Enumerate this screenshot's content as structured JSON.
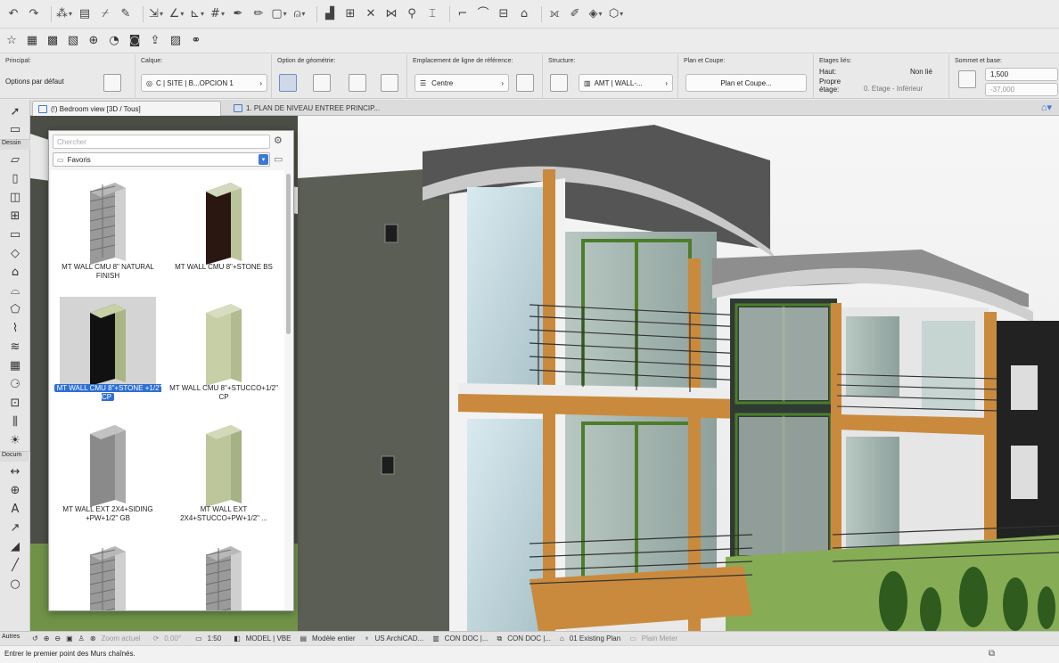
{
  "colors": {
    "accent": "#2f6fd6",
    "sky": "#f3f3f3",
    "grass": "#86ad55"
  },
  "toolbar1": [
    "undo-icon",
    "redo-icon",
    "magic-wand-icon",
    "layout-icon",
    "eyedropper-icon",
    "injection-icon",
    "arrow-tool-icon",
    "angle-icon",
    "snap-guide-icon",
    "grid-snap-icon",
    "pen-icon",
    "pencil-icon",
    "square-icon",
    "lock-icon",
    "stair-icon",
    "table-icon",
    "cross-icon",
    "split-icon",
    "magnify-icon",
    "trim-icon",
    "corner-icon",
    "curve-icon",
    "align-icon",
    "home-icon",
    "intersect-icon",
    "paint-icon",
    "layers-icon",
    "view-3d-icon"
  ],
  "toolbar2": [
    "star-icon",
    "plan-icon",
    "section-icon",
    "map-icon",
    "globe-icon",
    "camera-icon",
    "render-icon",
    "publish-icon",
    "detail-icon",
    "teamwork-icon"
  ],
  "info": {
    "principal_label": "Principal:",
    "principal_value": "Options par défaut",
    "calque_label": "Calque:",
    "calque_value": "C | SITE | B...OPCION 1",
    "geometry_label": "Option de géométrie:",
    "refline_label": "Emplacement de ligne de référence:",
    "refline_value": "Centre",
    "structure_label": "Structure:",
    "structure_value": "AMT | WALL-...",
    "plancoupe_label": "Plan et Coupe:",
    "plancoupe_value": "Plan et Coupe...",
    "etages_label": "Etages liés:",
    "haut_label": "Haut:",
    "haut_value": "Non lié",
    "propre_label": "Propre\nétage:",
    "propre_value": "0. Etage - Inférieur",
    "sommet_label": "Sommet et base:",
    "sommet_value": "1,500",
    "base_value": "-37,000"
  },
  "tabs": [
    "(!) Bedroom view [3D / Tous]",
    "1. PLAN DE NIVEAU ENTREE PRINCIP..."
  ],
  "left_sections": {
    "dessin": "Dessin",
    "docum": "Docum",
    "autres": "Autres"
  },
  "left_tools_top": [
    "pointer-icon",
    "marquee-icon"
  ],
  "left_tools_dessin": [
    "wall-icon",
    "column-icon",
    "door-icon",
    "window-icon",
    "beam-icon",
    "slab-icon",
    "roof-icon",
    "shell-icon",
    "morph-icon",
    "mesh-icon",
    "stair-tool-icon",
    "curtain-wall-icon",
    "object-icon",
    "zone-icon",
    "railing-icon",
    "lamp-icon"
  ],
  "left_tools_docum": [
    "dimension-icon",
    "level-icon",
    "text-icon",
    "label-icon",
    "fill-icon",
    "line-icon",
    "circle-icon"
  ],
  "panel": {
    "search_placeholder": "Chercher",
    "folder": "Favoris",
    "items": [
      {
        "caption": "MT WALL CMU 8\" NATURAL FINISH",
        "face": "#9a9a9a",
        "side": "#cfcfcf",
        "top": "#b8b8b8",
        "pattern": true
      },
      {
        "caption": "MT WALL CMU 8\"+STONE BS",
        "face": "#2b1712",
        "side": "#b9c49b",
        "top": "#d3d9bb",
        "pattern": false
      },
      {
        "caption": "MT WALL CMU 8\"+STONE +1/2\" CP",
        "face": "#111111",
        "side": "#a9b584",
        "top": "#c8d0a8",
        "pattern": false
      },
      {
        "caption": "MT WALL CMU 8\"+STUCCO+1/2\" CP",
        "face": "#c7cfa6",
        "side": "#b1bb8f",
        "top": "#d8ddc0",
        "pattern": false
      },
      {
        "caption": "MT WALL EXT 2X4+SIDING +PW+1/2\" GB",
        "face": "#8a8a8a",
        "side": "#a9a9a9",
        "top": "#c2c2c2",
        "pattern": false
      },
      {
        "caption": "MT WALL EXT 2X4+STUCCO+PW+1/2\" ...",
        "face": "#bdc59b",
        "side": "#a7b186",
        "top": "#d3d8b9",
        "pattern": false
      },
      {
        "caption": "",
        "face": "#9a9a9a",
        "side": "#cfcfcf",
        "top": "#b8b8b8",
        "pattern": true
      },
      {
        "caption": "",
        "face": "#9a9a9a",
        "side": "#cfcfcf",
        "top": "#b8b8b8",
        "pattern": true
      }
    ],
    "selected_index": 2
  },
  "status": {
    "zoom": "Zoom actuel",
    "angle": "0,00°",
    "scale": "1:50",
    "model": "MODEL | VBE",
    "model_view": "Modèle entier",
    "standard": "US ArchiCAD...",
    "condoc1": "CON DOC |...",
    "condoc2": "CON DOC |...",
    "story": "01 Existing Plan",
    "unit": "Plain Meter"
  },
  "prompt": "Entrer le premier point des Murs chaînés."
}
